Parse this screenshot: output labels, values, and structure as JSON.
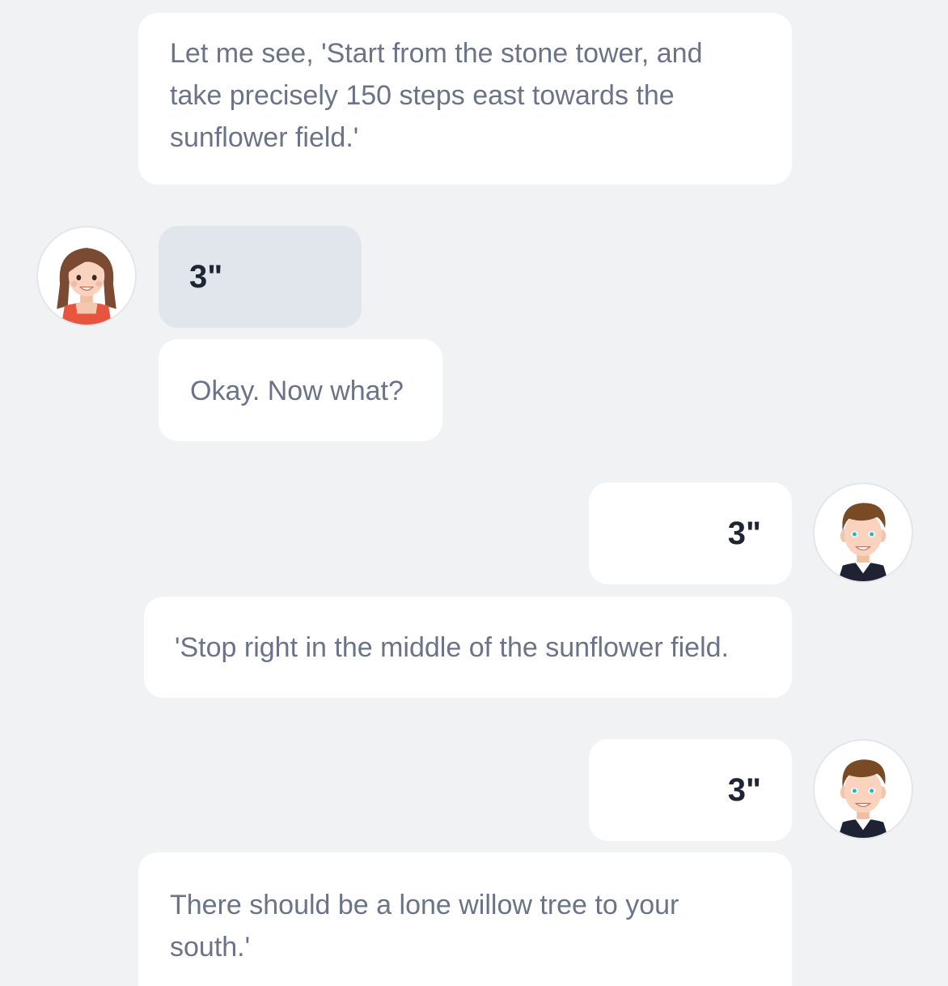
{
  "messages": [
    {
      "id": "m1",
      "sender": "guide",
      "kind": "text",
      "text": "Let me see, 'Start from the stone tower, and take precisely 150 steps east towards the sunflower field.'"
    },
    {
      "id": "m2",
      "sender": "girl",
      "kind": "audio",
      "duration": "3\""
    },
    {
      "id": "m3",
      "sender": "girl",
      "kind": "text",
      "text": "Okay. Now what?"
    },
    {
      "id": "m4",
      "sender": "boy",
      "kind": "audio",
      "duration": "3\""
    },
    {
      "id": "m5",
      "sender": "guide",
      "kind": "text",
      "text": "'Stop right in the middle of the sunflower field."
    },
    {
      "id": "m6",
      "sender": "boy",
      "kind": "audio",
      "duration": "3\""
    },
    {
      "id": "m7",
      "sender": "guide",
      "kind": "text",
      "text": "There should be a lone willow tree to your south.'"
    }
  ],
  "avatars": {
    "girl": {
      "icon": "girl-avatar-icon"
    },
    "boy": {
      "icon": "boy-avatar-icon"
    }
  },
  "colors": {
    "background": "#f1f2f4",
    "bubble": "#ffffff",
    "bubble_highlight": "#e1e5ec",
    "text_muted": "#6b7388",
    "text_strong": "#1f2533"
  }
}
